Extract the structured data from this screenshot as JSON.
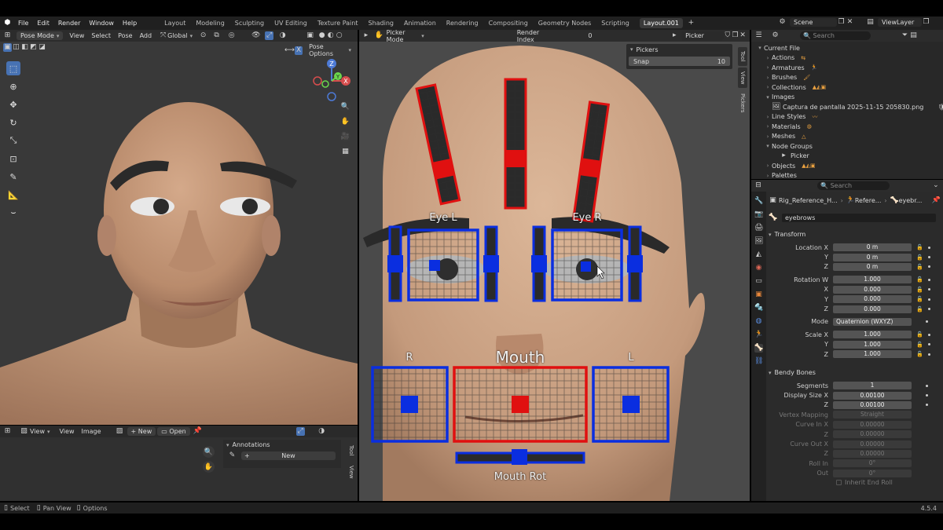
{
  "menu": [
    "File",
    "Edit",
    "Render",
    "Window",
    "Help"
  ],
  "workspaces": [
    "Layout",
    "Modeling",
    "Sculpting",
    "UV Editing",
    "Texture Paint",
    "Shading",
    "Animation",
    "Rendering",
    "Compositing",
    "Geometry Nodes",
    "Scripting",
    "Layout.001"
  ],
  "active_workspace": "Layout.001",
  "scene_name": "Scene",
  "view_layer": "ViewLayer",
  "viewport": {
    "mode": "Pose Mode",
    "menus": [
      "View",
      "Select",
      "Pose",
      "Add"
    ],
    "orientation": "Global",
    "pose_options": "Pose Options",
    "axes": {
      "x": "X",
      "y": "Y",
      "z": "Z"
    }
  },
  "image_editor": {
    "view_dropdown": "View",
    "menus": [
      "View",
      "Image"
    ],
    "new_label": "New",
    "open_label": "Open",
    "annotations_title": "Annotations",
    "annotations_new": "New",
    "tabs": [
      "Tool",
      "View"
    ]
  },
  "picker": {
    "mode": "Picker Mode",
    "render_index_label": "Render Index",
    "render_index_value": "0",
    "picker_label": "Picker",
    "panel_title": "Pickers",
    "snap_label": "Snap",
    "snap_value": "10",
    "tabs": [
      "Tool",
      "View",
      "Pickers"
    ],
    "labels": {
      "eye_l": "Eye L",
      "eye_r": "Eye R",
      "mouth": "Mouth",
      "r": "R",
      "l": "L",
      "mouth_rot": "Mouth Rot"
    }
  },
  "outliner": {
    "search_placeholder": "Search",
    "items": [
      {
        "label": "Current File",
        "indent": 0,
        "open": true
      },
      {
        "label": "Actions",
        "indent": 1
      },
      {
        "label": "Armatures",
        "indent": 1
      },
      {
        "label": "Brushes",
        "indent": 1
      },
      {
        "label": "Collections",
        "indent": 1
      },
      {
        "label": "Images",
        "indent": 1,
        "open": true
      },
      {
        "label": "Captura de pantalla 2025-11-15 205830.png",
        "indent": 2
      },
      {
        "label": "Line Styles",
        "indent": 1
      },
      {
        "label": "Materials",
        "indent": 1
      },
      {
        "label": "Meshes",
        "indent": 1
      },
      {
        "label": "Node Groups",
        "indent": 1,
        "open": true
      },
      {
        "label": "Picker",
        "indent": 2
      },
      {
        "label": "Objects",
        "indent": 1
      },
      {
        "label": "Palettes",
        "indent": 1
      }
    ]
  },
  "properties": {
    "search_placeholder": "Search",
    "breadcrumb": [
      "Rig_Reference_H...",
      "Refere...",
      "eyebr..."
    ],
    "bone_name": "eyebrows",
    "transform_title": "Transform",
    "rows": [
      {
        "label": "Location X",
        "value": "0 m",
        "lock": true
      },
      {
        "label": "Y",
        "value": "0 m",
        "lock": true
      },
      {
        "label": "Z",
        "value": "0 m",
        "lock": true
      },
      {
        "label": "Rotation W",
        "value": "1.000",
        "lock": true
      },
      {
        "label": "X",
        "value": "0.000",
        "lock": true
      },
      {
        "label": "Y",
        "value": "0.000",
        "lock": true
      },
      {
        "label": "Z",
        "value": "0.000",
        "lock": true
      },
      {
        "label": "Mode",
        "value": "Quaternion (WXYZ)",
        "dropdown": true
      },
      {
        "label": "Scale X",
        "value": "1.000",
        "lock": true
      },
      {
        "label": "Y",
        "value": "1.000",
        "lock": true
      },
      {
        "label": "Z",
        "value": "1.000",
        "lock": true
      }
    ],
    "bendy_title": "Bendy Bones",
    "bendy_rows": [
      {
        "label": "Segments",
        "value": "1"
      },
      {
        "label": "Display Size X",
        "value": "0.00100"
      },
      {
        "label": "Z",
        "value": "0.00100"
      },
      {
        "label": "Vertex Mapping",
        "value": "Straight",
        "disabled": true
      },
      {
        "label": "Curve In X",
        "value": "0.00000",
        "disabled": true
      },
      {
        "label": "Z",
        "value": "0.00000",
        "disabled": true
      },
      {
        "label": "Curve Out X",
        "value": "0.00000",
        "disabled": true
      },
      {
        "label": "Z",
        "value": "0.00000",
        "disabled": true
      },
      {
        "label": "Roll In",
        "value": "0°",
        "disabled": true
      },
      {
        "label": "Out",
        "value": "0°",
        "disabled": true
      }
    ],
    "inherit_end_roll": "Inherit End Roll"
  },
  "status": {
    "select": "Select",
    "pan_view": "Pan View",
    "options": "Options",
    "version": "4.5.4"
  },
  "colors": {
    "accent": "#4772b3",
    "picker_red": "#e01010",
    "picker_blue": "#0a2ee0"
  }
}
